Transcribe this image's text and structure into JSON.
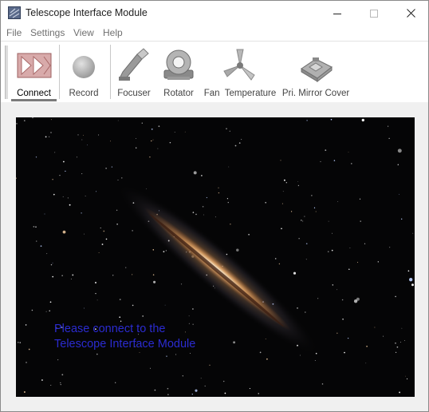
{
  "window": {
    "title": "Telescope Interface Module",
    "icon": "telescope-app-icon"
  },
  "window_controls": [
    {
      "name": "minimize-button",
      "icon": "minimize-icon"
    },
    {
      "name": "maximize-button",
      "icon": "maximize-icon"
    },
    {
      "name": "close-button",
      "icon": "close-icon"
    }
  ],
  "menu": {
    "file": "File",
    "settings": "Settings",
    "view": "View",
    "help": "Help"
  },
  "toolbar": {
    "connect": "Connect",
    "record": "Record",
    "focuser": "Focuser",
    "rotator": "Rotator",
    "fan_temperature": "Fan  Temperature",
    "mirror_cover": "Pri. Mirror Cover"
  },
  "viewer": {
    "message_line1": "Please connect to the",
    "message_line2": "Telescope Interface Module",
    "message_color": "#2b2bd0",
    "background": "galaxy-starfield-image"
  },
  "colors": {
    "connect_icon": "#d8a8a8",
    "connect_icon_dark": "#b06a6a"
  }
}
